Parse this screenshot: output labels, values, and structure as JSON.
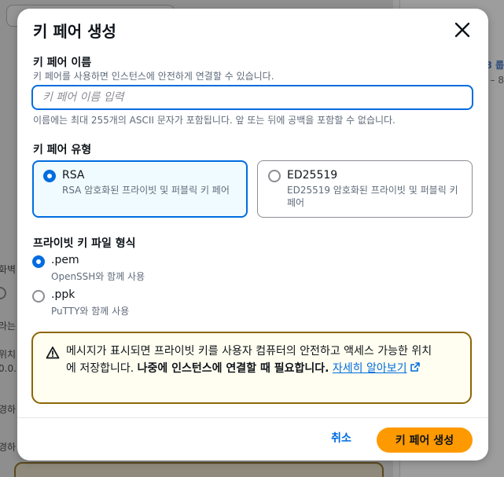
{
  "background": {
    "right_link": "8 룹",
    "right_sub": "– 8",
    "left_fragments": [
      "화벽",
      "라는",
      "위치",
      "0.0.",
      "경하",
      "경하"
    ]
  },
  "modal": {
    "title": "키 페어 생성",
    "close_icon": "close-icon",
    "key_name": {
      "label": "키 페어 이름",
      "description": "키 페어를 사용하면 인스턴스에 안전하게 연결할 수 있습니다.",
      "placeholder": "키 페어 이름 입력",
      "value": "",
      "constraint": "이름에는 최대 255개의 ASCII 문자가 포함됩니다. 앞 또는 뒤에 공백을 포함할 수 없습니다."
    },
    "key_type": {
      "label": "키 페어 유형",
      "options": [
        {
          "title": "RSA",
          "description": "RSA 암호화된 프라이빗 및 퍼블릭 키 페어",
          "selected": true
        },
        {
          "title": "ED25519",
          "description": "ED25519 암호화된 프라이빗 및 퍼블릭 키 페어",
          "selected": false
        }
      ]
    },
    "file_format": {
      "label": "프라이빗 키 파일 형식",
      "options": [
        {
          "title": ".pem",
          "description": "OpenSSH와 함께 사용",
          "selected": true
        },
        {
          "title": ".ppk",
          "description": "PuTTY와 함께 사용",
          "selected": false
        }
      ]
    },
    "alert": {
      "icon": "warning-icon",
      "text_plain": "메시지가 표시되면 프라이빗 키를 사용자 컴퓨터의 안전하고 액세스 가능한 위치에 저장합니다. ",
      "text_bold": "나중에 인스턴스에 연결할 때 필요합니다.",
      "link": "자세히 알아보기",
      "link_icon": "external-link-icon"
    },
    "footer": {
      "cancel_label": "취소",
      "submit_label": "키 페어 생성"
    }
  },
  "colors": {
    "accent": "#006ce0",
    "primary_button": "#ff9900",
    "warning_border": "#8d6605",
    "warning_bg": "#fffef0"
  }
}
